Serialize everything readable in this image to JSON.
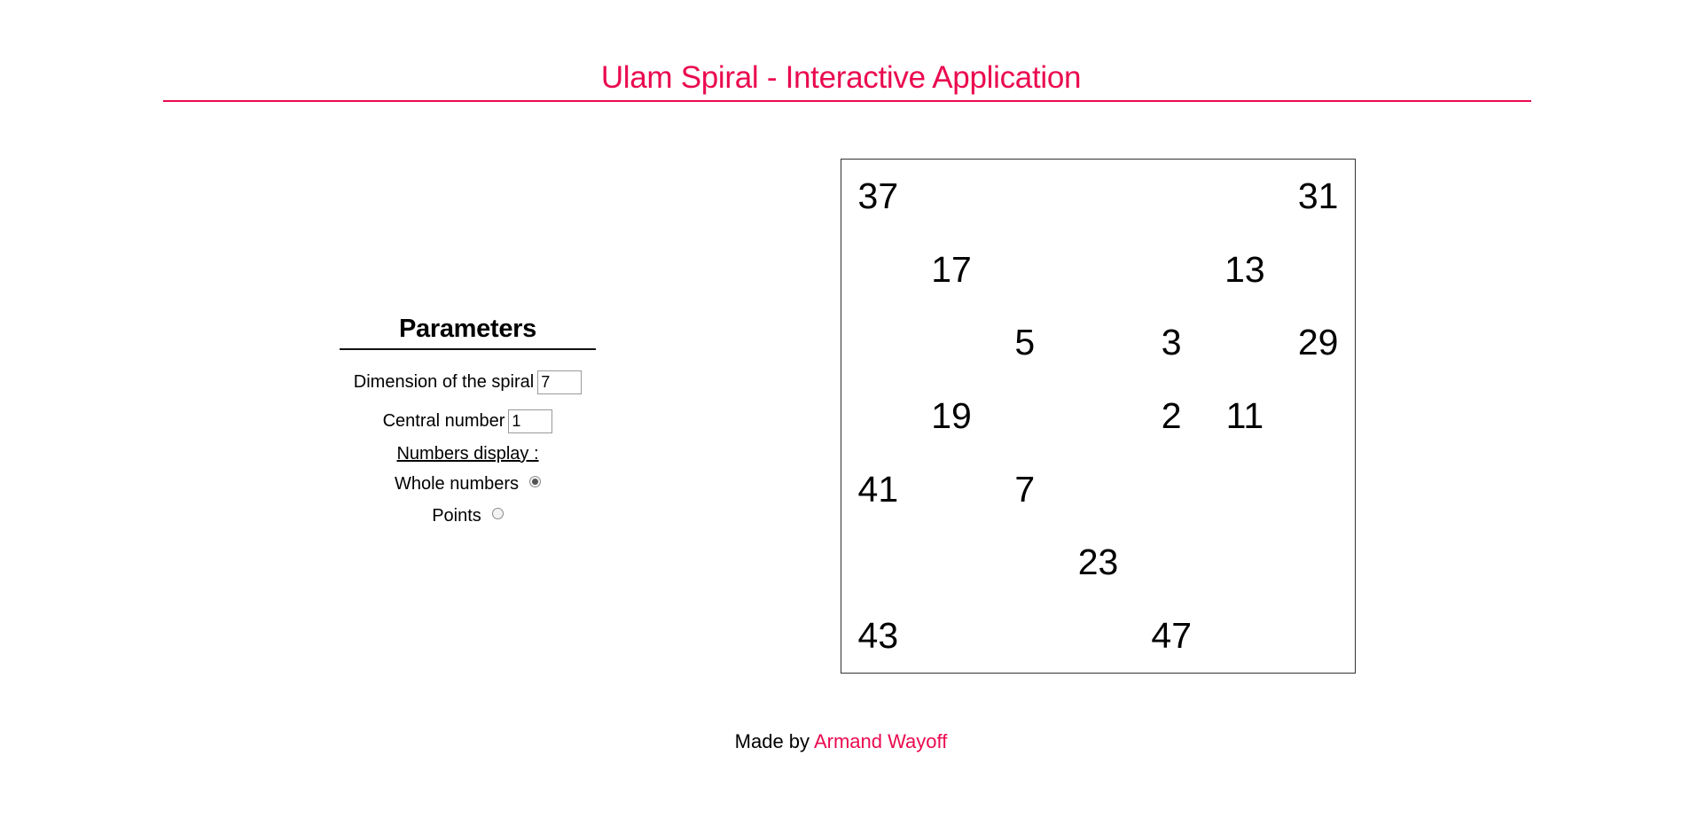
{
  "header": {
    "title": "Ulam Spiral - Interactive Application"
  },
  "parameters": {
    "title": "Parameters",
    "dimension_label": "Dimension of the spiral",
    "dimension_value": "7",
    "central_label": "Central number",
    "central_value": "1",
    "display_heading": "Numbers display :",
    "options": [
      {
        "label": "Whole numbers",
        "selected": true
      },
      {
        "label": "Points",
        "selected": false
      }
    ]
  },
  "spiral": {
    "dimension": 7,
    "primes": [
      {
        "value": "37",
        "row": 0,
        "col": 0
      },
      {
        "value": "31",
        "row": 0,
        "col": 6
      },
      {
        "value": "17",
        "row": 1,
        "col": 1
      },
      {
        "value": "13",
        "row": 1,
        "col": 5
      },
      {
        "value": "5",
        "row": 2,
        "col": 2
      },
      {
        "value": "3",
        "row": 2,
        "col": 4
      },
      {
        "value": "29",
        "row": 2,
        "col": 6
      },
      {
        "value": "19",
        "row": 3,
        "col": 1
      },
      {
        "value": "2",
        "row": 3,
        "col": 4
      },
      {
        "value": "11",
        "row": 3,
        "col": 5
      },
      {
        "value": "41",
        "row": 4,
        "col": 0
      },
      {
        "value": "7",
        "row": 4,
        "col": 2
      },
      {
        "value": "23",
        "row": 5,
        "col": 3
      },
      {
        "value": "43",
        "row": 6,
        "col": 0
      },
      {
        "value": "47",
        "row": 6,
        "col": 4
      }
    ]
  },
  "footer": {
    "prefix": "Made by",
    "author": "Armand Wayoff"
  },
  "colors": {
    "accent": "#ea0a4f"
  }
}
